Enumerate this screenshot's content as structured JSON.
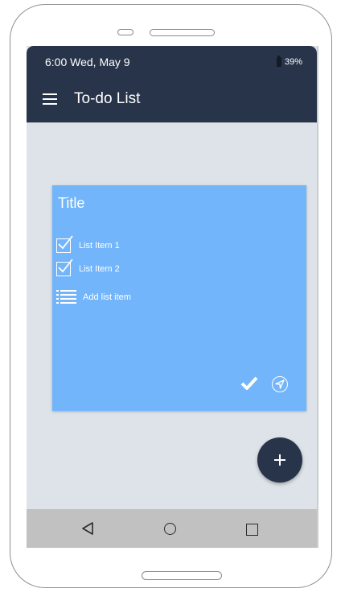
{
  "status_bar": {
    "time_date": "6:00  Wed, May 9",
    "battery": "39%"
  },
  "app_bar": {
    "title": "To-do List",
    "menu_icon": "hamburger-icon"
  },
  "card": {
    "title": "Title",
    "items": [
      {
        "label": "List Item 1",
        "checked": true
      },
      {
        "label": "List Item 2",
        "checked": true
      }
    ],
    "add_label": "Add list item",
    "actions": [
      "check-icon",
      "navigate-icon"
    ],
    "color": "#72b5fb"
  },
  "fab": {
    "icon": "plus-icon"
  },
  "system_nav": {
    "icons": [
      "back-icon",
      "home-icon",
      "recents-icon"
    ]
  },
  "colors": {
    "app_bar": "#283449",
    "background": "#dde3e8",
    "card": "#72b5fb"
  }
}
